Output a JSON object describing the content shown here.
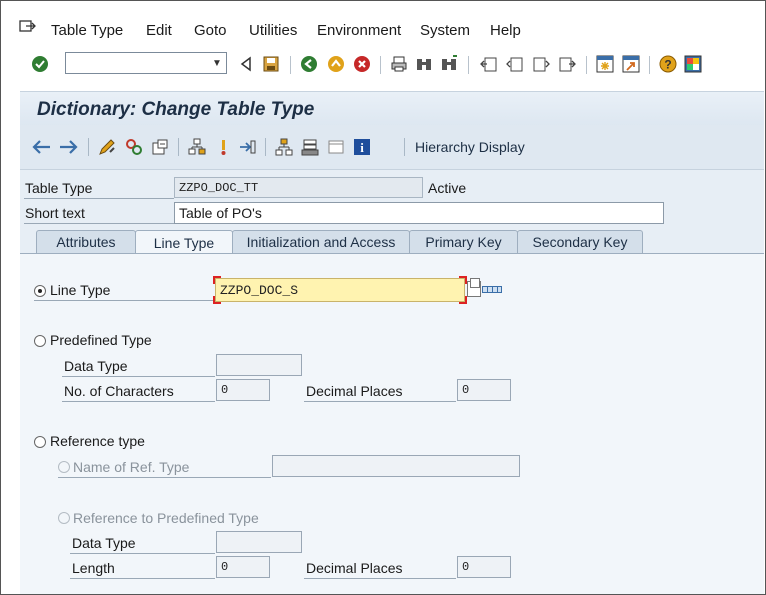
{
  "menu": {
    "items": [
      "Table Type",
      "Edit",
      "Goto",
      "Utilities",
      "Environment",
      "System",
      "Help"
    ]
  },
  "toolbar": {
    "command_value": "",
    "icons": [
      "enter-icon",
      "back-icon",
      "save-icon",
      "navigate-back-icon",
      "exit-icon",
      "cancel-icon",
      "print-icon",
      "find-icon",
      "find-next-icon",
      "first-page-icon",
      "previous-page-icon",
      "next-page-icon",
      "last-page-icon",
      "new-session-icon",
      "shortcut-icon",
      "help-icon",
      "customize-layout-icon"
    ]
  },
  "screen": {
    "title": "Dictionary: Change Table Type",
    "hierarchy_display": "Hierarchy Display"
  },
  "header": {
    "table_type_label": "Table Type",
    "table_type_value": "ZZPO_DOC_TT",
    "status": "Active",
    "short_text_label": "Short text",
    "short_text_value": "Table of PO's"
  },
  "tabs": [
    {
      "label": "Attributes",
      "active": false
    },
    {
      "label": "Line Type",
      "active": true
    },
    {
      "label": "Initialization and Access",
      "active": false
    },
    {
      "label": "Primary Key",
      "active": false
    },
    {
      "label": "Secondary Key",
      "active": false
    }
  ],
  "line_type_tab": {
    "line_type_label": "Line Type",
    "line_type_value": "ZZPO_DOC_S",
    "predefined_type_label": "Predefined Type",
    "data_type_label": "Data Type",
    "data_type_value": "",
    "no_chars_label": "No. of Characters",
    "no_chars_value": "0",
    "decimal_places_label": "Decimal Places",
    "decimal_places_value": "0",
    "reference_type_label": "Reference type",
    "name_ref_type_label": "Name of Ref. Type",
    "name_ref_type_value": "",
    "ref_predefined_label": "Reference to Predefined Type",
    "ref_data_type_label": "Data Type",
    "ref_data_type_value": "",
    "length_label": "Length",
    "length_value": "0",
    "ref_decimal_places_label": "Decimal Places",
    "ref_decimal_places_value": "0"
  },
  "colors": {
    "title_bg": "#e9f0f7",
    "panel_bg": "#f2f6fa",
    "highlight_field": "#fff3b0",
    "accent_dark": "#1d2f45"
  }
}
